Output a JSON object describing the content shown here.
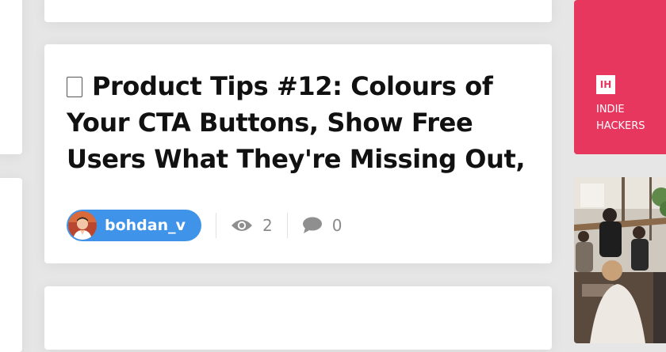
{
  "post": {
    "title": "Product Tips #12: Colours of Your CTA Buttons, Show Free Users What They're Missing Out,",
    "author": "bohdan_v",
    "views": "2",
    "comments": "0"
  },
  "sidebar_card": {
    "logo": "IH",
    "brand_line1": "INDIE",
    "brand_line2": "HACKERS"
  },
  "icons": {
    "title_glyph": "box-icon",
    "views": "eye-icon",
    "comments": "comment-bubble-icon"
  },
  "colors": {
    "background": "#e6e6e6",
    "user_chip": "#3f93e8",
    "brand_red": "#e8375f",
    "title_text": "#111111",
    "stat_text": "#8a8a8a"
  }
}
